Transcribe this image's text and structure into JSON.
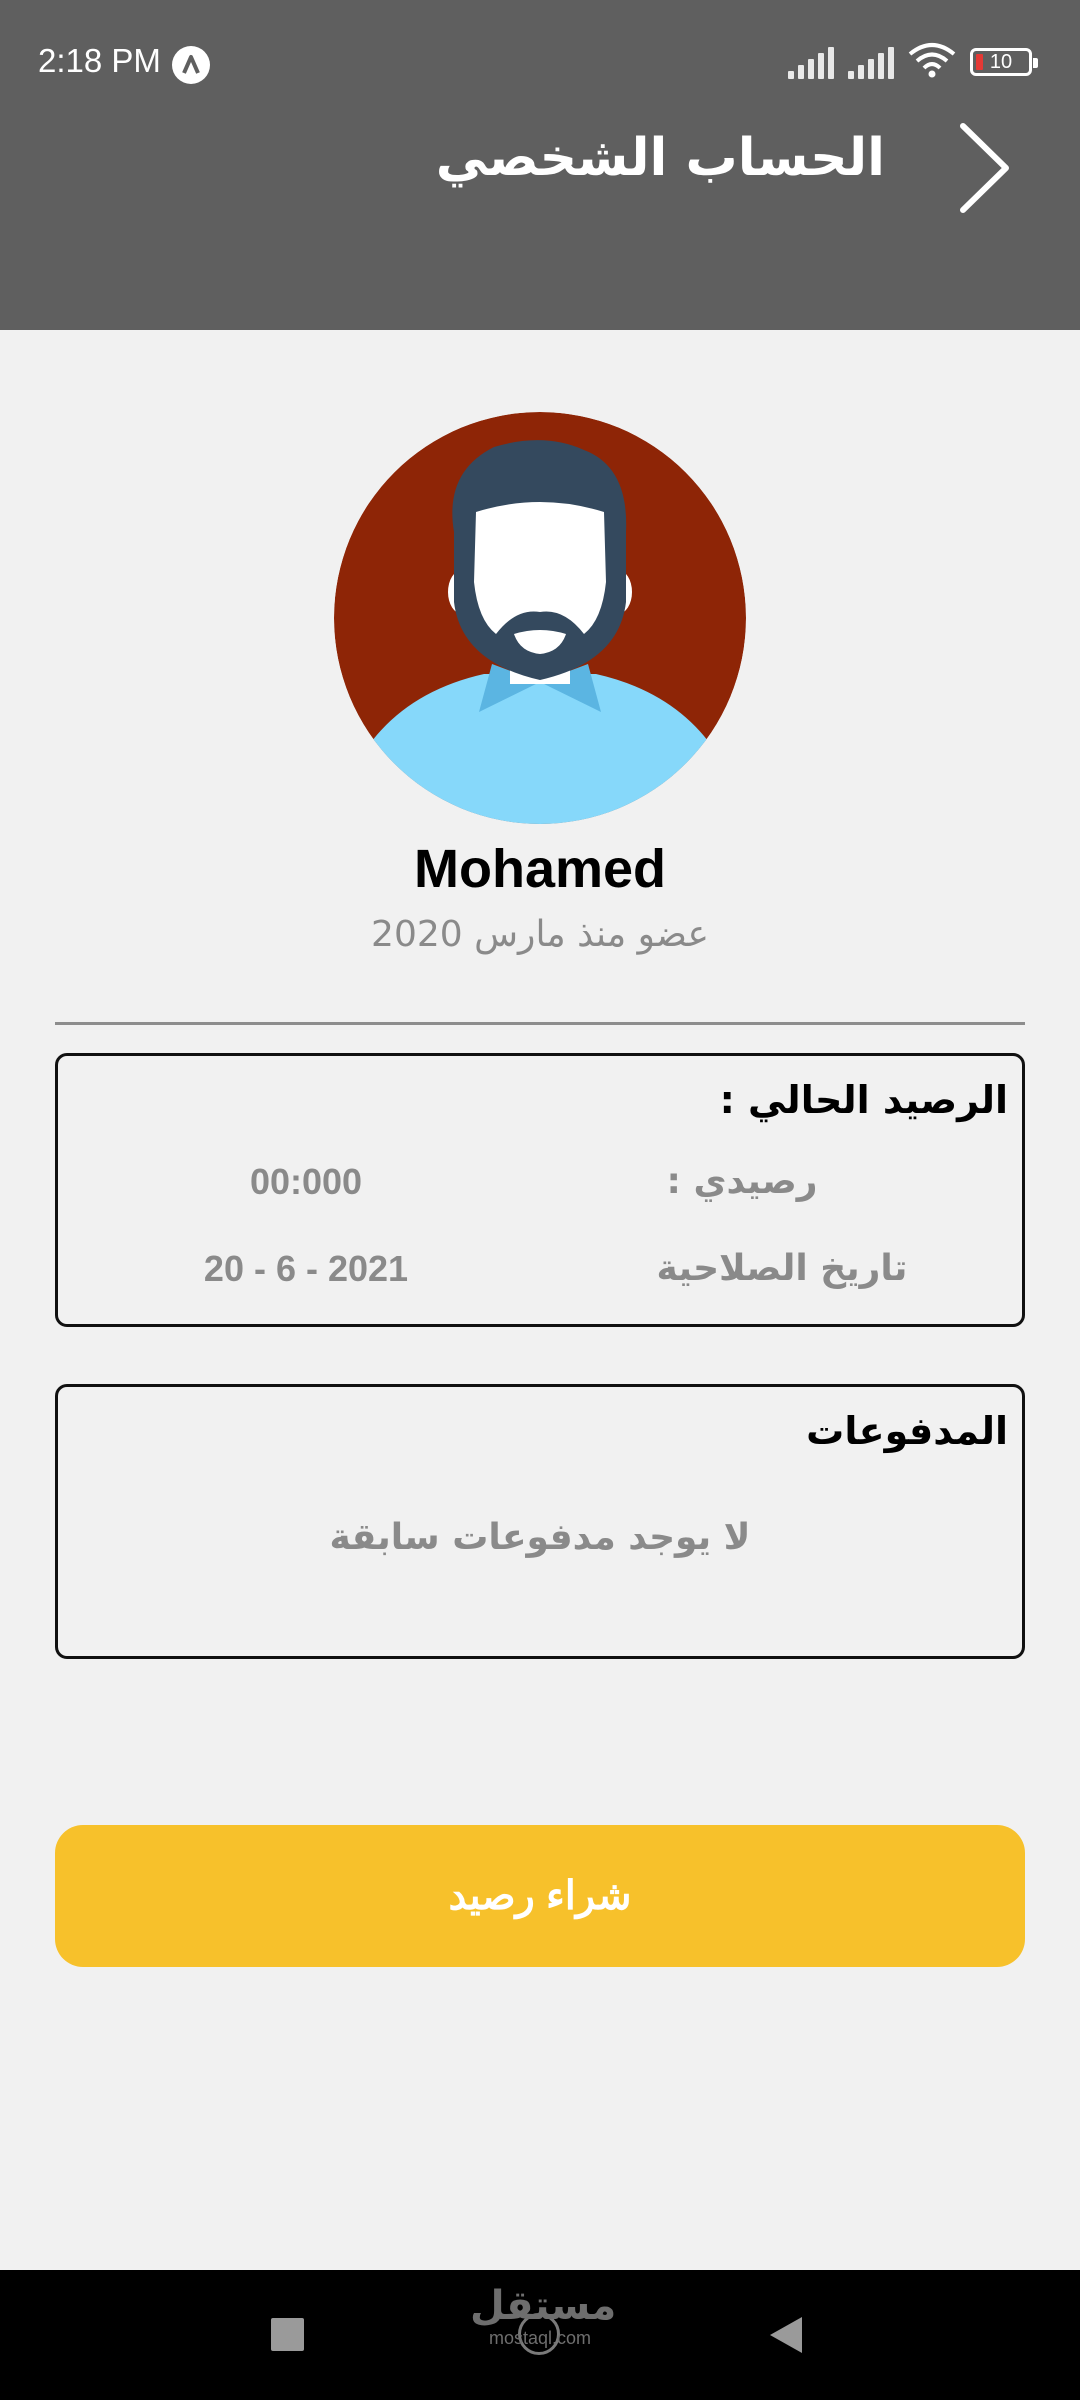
{
  "status_bar": {
    "time": "2:18 PM",
    "battery": "10",
    "icons": [
      "app-notification-icon",
      "signal-icon",
      "signal-icon",
      "wifi-icon",
      "battery-icon"
    ]
  },
  "header": {
    "title": "الحساب الشخصي",
    "back_icon": "chevron-right-icon",
    "background": "#5f5f5f"
  },
  "profile": {
    "name": "Mohamed",
    "member_since": "عضو منذ مارس 2020",
    "avatar_icon": "user-avatar-icon",
    "avatar_bg": "#8e2506"
  },
  "balance": {
    "title": "الرصيد الحالي :",
    "balance_label": "رصيدي :",
    "balance_value": "00:000",
    "expiry_label": "تاريخ الصلاحية",
    "expiry_value": "20 - 6 - 2021"
  },
  "payments": {
    "title": "المدفوعات",
    "empty_text": "لا يوجد مدفوعات سابقة"
  },
  "buy_button": {
    "label": "شراء رصيد",
    "color": "#f7c12b"
  },
  "nav_bar": {
    "icons": [
      "recents-icon",
      "home-icon",
      "back-icon"
    ]
  },
  "watermark": {
    "main": "مستقل",
    "sub": "mostaql.com"
  }
}
